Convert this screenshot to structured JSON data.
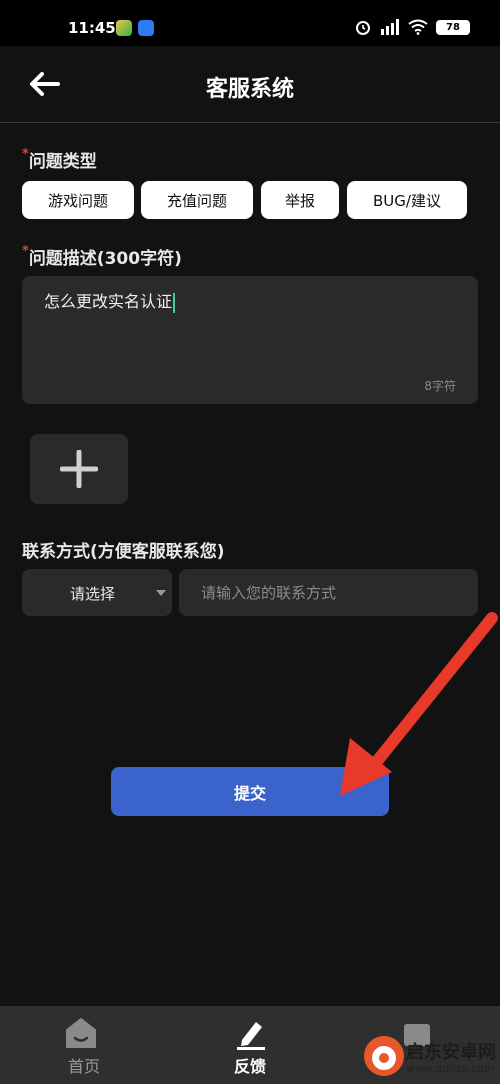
{
  "status_bar": {
    "time": "11:45",
    "battery": "78"
  },
  "header": {
    "title": "客服系统"
  },
  "problem_type": {
    "required_mark": "*",
    "label": "问题类型",
    "options": [
      "游戏问题",
      "充值问题",
      "举报",
      "BUG/建议"
    ]
  },
  "description": {
    "required_mark": "*",
    "label": "问题描述(300字符)",
    "value": "怎么更改实名认证",
    "char_count": "8字符"
  },
  "contact": {
    "label": "联系方式(方便客服联系您)",
    "select_value": "请选择",
    "input_placeholder": "请输入您的联系方式"
  },
  "submit": {
    "label": "提交"
  },
  "bottom_nav": {
    "items": [
      {
        "label": "首页",
        "icon": "home-icon"
      },
      {
        "label": "反馈",
        "icon": "edit-icon"
      },
      {
        "label": "",
        "icon": "chat-icon"
      }
    ]
  },
  "watermark": {
    "text": "启东安卓网",
    "url": "www.qdtdq.com"
  },
  "colors": {
    "accent": "#3a63cc",
    "required": "#e0433a",
    "background": "#121212",
    "arrow": "#e83a2a"
  }
}
